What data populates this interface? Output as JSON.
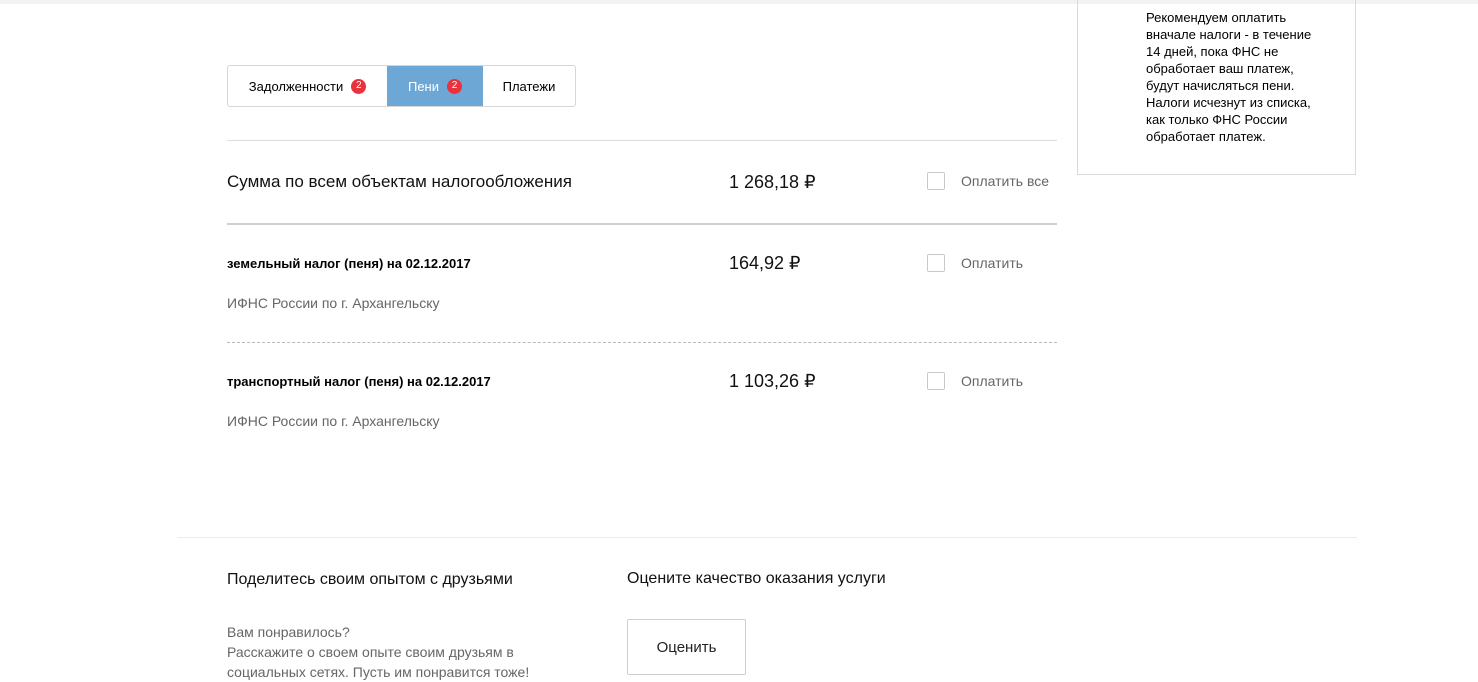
{
  "tabs": [
    {
      "label": "Задолженности",
      "badge": "2"
    },
    {
      "label": "Пени",
      "badge": "2"
    },
    {
      "label": "Платежи"
    }
  ],
  "info": {
    "text": "Рекомендуем оплатить\nвначале налоги - в течение\n14 дней, пока ФНС не\nобработает ваш платеж,\nбудут начисляться пени.\nНалоги исчезнут из списка,\nкак только ФНС России\nобработает платеж."
  },
  "summary": {
    "label": "Сумма по всем объектам налогообложения",
    "amount": "1 268,18 ₽",
    "pay_all_label": "Оплатить все"
  },
  "items": [
    {
      "title": "земельный налог (пеня) на 02.12.2017",
      "org": "ИФНС России по г. Архангельску",
      "amount": "164,92 ₽",
      "pay_label": "Оплатить"
    },
    {
      "title": "транспортный налог (пеня) на 02.12.2017",
      "org": "ИФНС России по г. Архангельску",
      "amount": "1 103,26 ₽",
      "pay_label": "Оплатить"
    }
  ],
  "footer": {
    "share_title": "Поделитесь своим опытом с друзьями",
    "share_line1": "Вам понравилось?",
    "share_line2": "Расскажите о своем опыте своим друзьям в",
    "share_line3": "социальных сетях. Пусть им понравится тоже!",
    "rate_title": "Оцените качество оказания услуги",
    "rate_button": "Оценить"
  },
  "colors": {
    "active_tab": "#6da7d5",
    "badge": "#e8323c"
  }
}
